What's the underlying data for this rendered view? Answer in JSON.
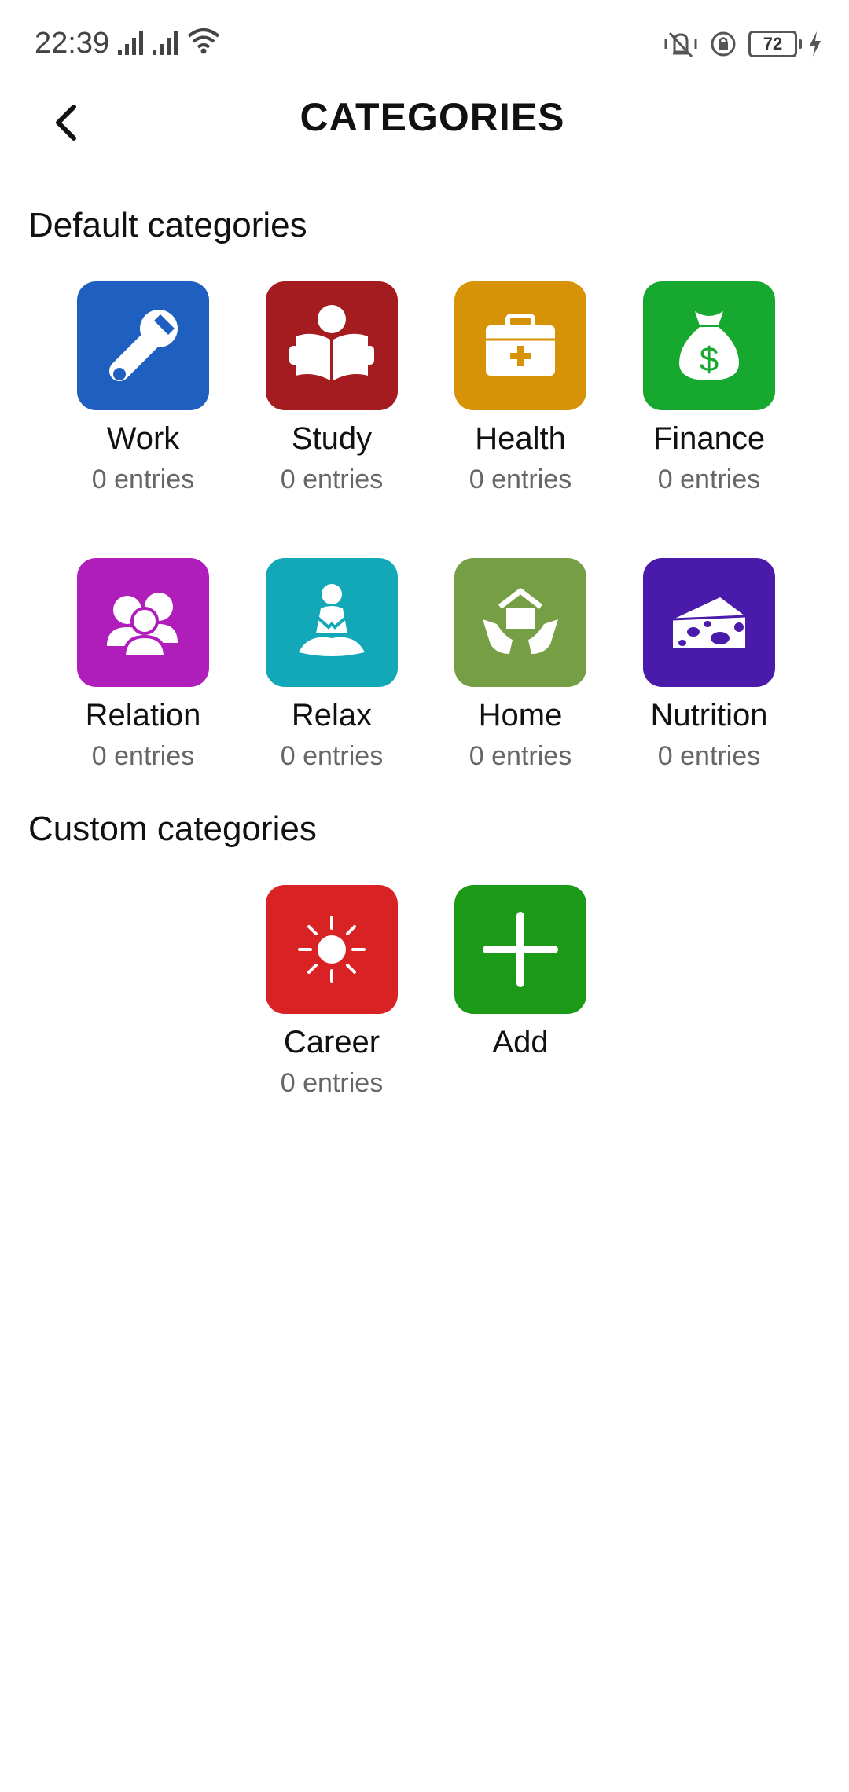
{
  "status": {
    "time": "22:39",
    "battery": "72"
  },
  "header": {
    "title": "CATEGORIES"
  },
  "sections": {
    "default_title": "Default categories",
    "custom_title": "Custom categories"
  },
  "default_categories": [
    {
      "label": "Work",
      "count": "0 entries",
      "color": "#1f5fbf",
      "icon": "tools-icon"
    },
    {
      "label": "Study",
      "count": "0 entries",
      "color": "#a51c20",
      "icon": "reading-icon"
    },
    {
      "label": "Health",
      "count": "0 entries",
      "color": "#d69307",
      "icon": "medkit-icon"
    },
    {
      "label": "Finance",
      "count": "0 entries",
      "color": "#17a92f",
      "icon": "money-bag-icon"
    },
    {
      "label": "Relation",
      "count": "0 entries",
      "color": "#af1eba",
      "icon": "people-icon"
    },
    {
      "label": "Relax",
      "count": "0 entries",
      "color": "#12a8b8",
      "icon": "meditation-icon"
    },
    {
      "label": "Home",
      "count": "0 entries",
      "color": "#769e45",
      "icon": "house-hands-icon"
    },
    {
      "label": "Nutrition",
      "count": "0 entries",
      "color": "#4a1aab",
      "icon": "cheese-icon"
    }
  ],
  "custom_categories": [
    {
      "label": "Career",
      "count": "0 entries",
      "color": "#d92224",
      "icon": "sun-icon"
    }
  ],
  "add_tile": {
    "label": "Add",
    "color": "#1a9a17",
    "icon": "plus-icon"
  }
}
